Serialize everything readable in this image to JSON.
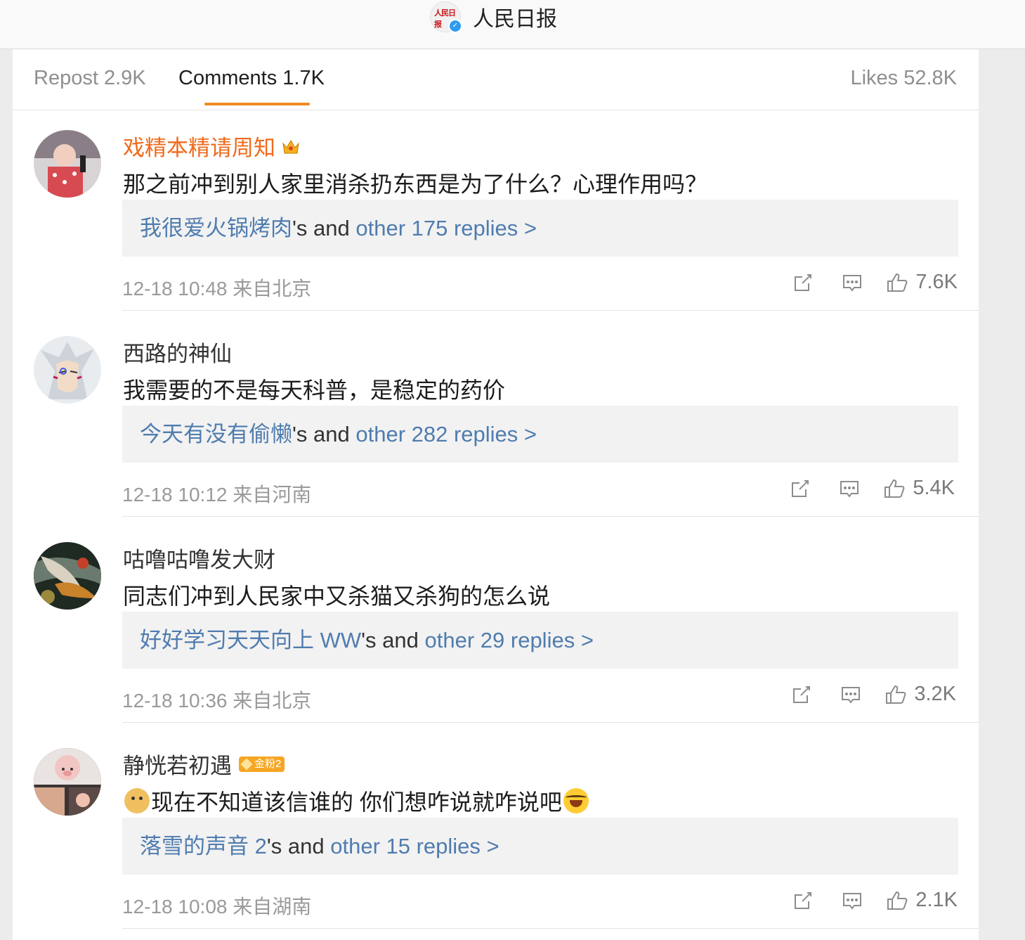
{
  "header": {
    "account_name": "人民日报",
    "logo_text": "人民日报",
    "verified_icon": "verified-check-icon"
  },
  "tabs": {
    "repost": "Repost 2.9K",
    "comments": "Comments 1.7K",
    "likes": "Likes 52.8K"
  },
  "accent_color": "#f08a24",
  "link_color": "#4f7caf",
  "comments": [
    {
      "username": "戏精本精请周知",
      "badge_icon": "crown-icon",
      "text": "那之前冲到别人家里消杀扔东西是为了什么？心理作用吗？",
      "reply_user": "我很爱火锅烤肉",
      "reply_mid": "'s and ",
      "reply_count": "other 175 replies >",
      "time": "12-18 10:48 来自北京",
      "likes": "7.6K"
    },
    {
      "username": "西路的神仙",
      "text": "我需要的不是每天科普，是稳定的药价",
      "reply_user": "今天有没有偷懒",
      "reply_mid": "'s and ",
      "reply_count": "other 282 replies >",
      "time": "12-18 10:12 来自河南",
      "likes": "5.4K"
    },
    {
      "username": "咕噜咕噜发大财",
      "text": "同志们冲到人民家中又杀猫又杀狗的怎么说",
      "reply_user": "好好学习天天向上 WW",
      "reply_mid": "'s and ",
      "reply_count": "other 29 replies >",
      "time": "12-18 10:36 来自北京",
      "likes": "3.2K"
    },
    {
      "username": "静恍若初遇",
      "badge": "金粉2",
      "text": "现在不知道该信谁的 你们想咋说就咋说吧",
      "reply_user": "落雪的声音 2",
      "reply_mid": "'s and ",
      "reply_count": "other 15 replies >",
      "time": "12-18 10:08 来自湖南",
      "likes": "2.1K"
    }
  ]
}
